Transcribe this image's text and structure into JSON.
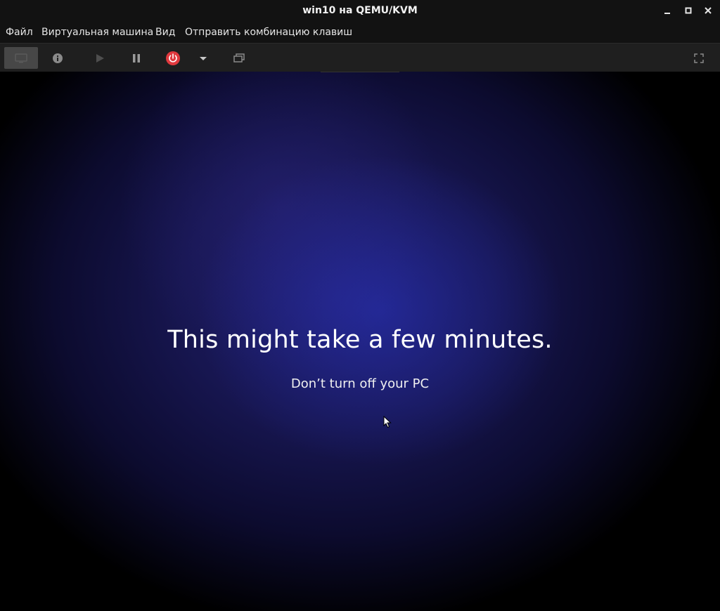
{
  "window": {
    "title": "win10 на QEMU/KVM"
  },
  "menubar": {
    "items": [
      {
        "label": "Файл"
      },
      {
        "label": "Виртуальная машина"
      },
      {
        "label": "Вид"
      },
      {
        "label": "Отправить комбинацию клавиш"
      }
    ]
  },
  "toolbar": {
    "buttons": [
      {
        "icon": "monitor-icon",
        "state": "active"
      },
      {
        "icon": "info-icon"
      },
      {
        "icon": "play-icon",
        "state": "disabled"
      },
      {
        "icon": "pause-icon"
      },
      {
        "icon": "power-icon",
        "color": "#e0393e"
      },
      {
        "icon": "chevron-down-icon"
      },
      {
        "icon": "snapshot-icon"
      },
      {
        "icon": "fullscreen-icon"
      }
    ]
  },
  "guest": {
    "headline": "This might take a few minutes.",
    "subtext": "Don’t turn off your PC"
  },
  "colors": {
    "chrome": "#121212",
    "toolbar": "#1f1f1f",
    "guest_accent": "#201e6a"
  }
}
